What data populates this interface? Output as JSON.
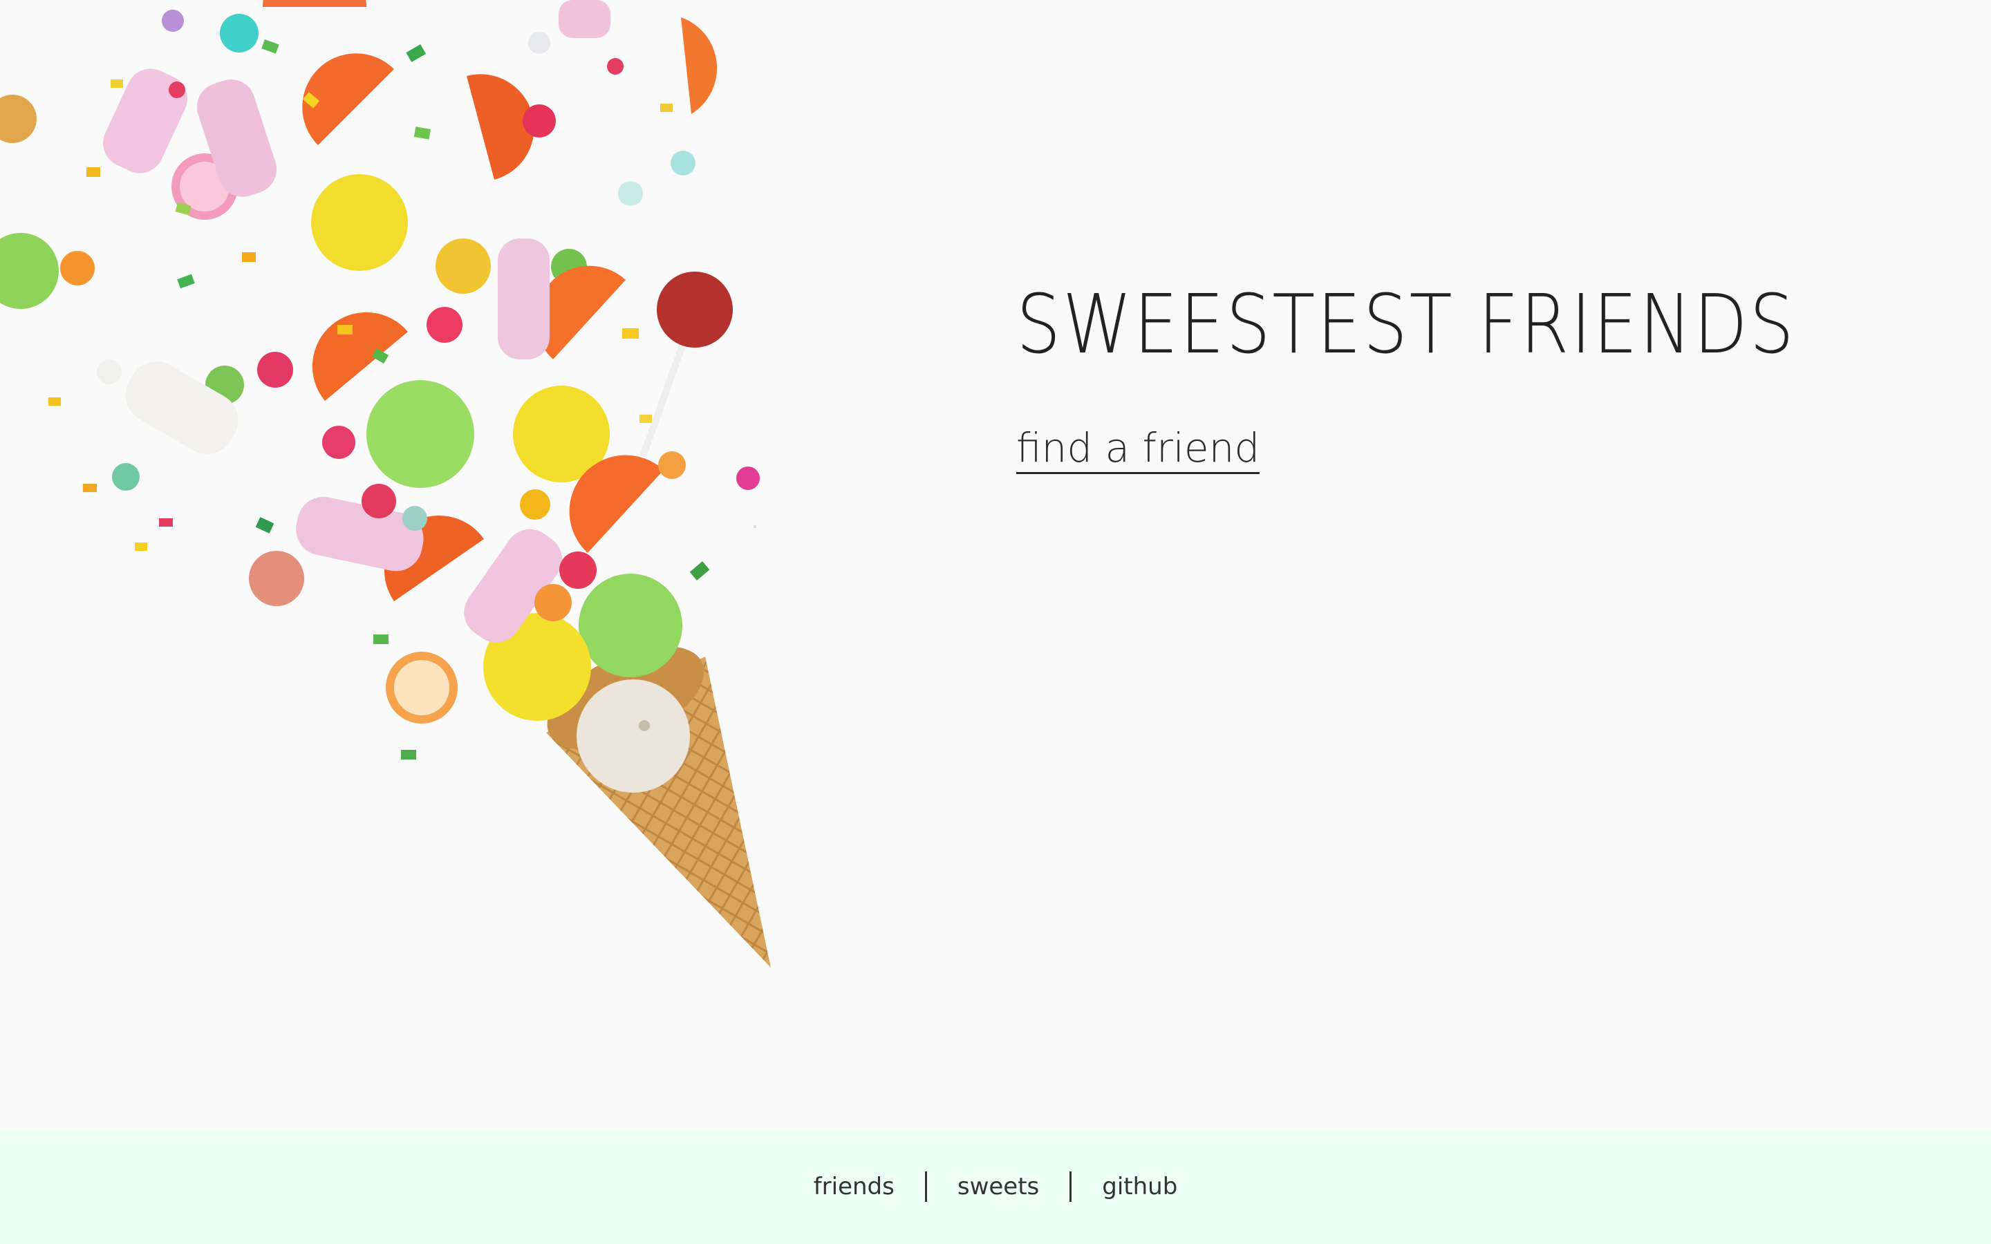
{
  "hero": {
    "title": "SWEESTEST FRIENDS",
    "cta_label": "find a friend",
    "image_alt": "candy exploding from waffle cone"
  },
  "footer": {
    "links": [
      {
        "label": "friends"
      },
      {
        "label": "sweets"
      },
      {
        "label": "github"
      }
    ]
  },
  "colors": {
    "background": "#fafafa",
    "footer_background": "#eefff7",
    "text": "#222222"
  }
}
